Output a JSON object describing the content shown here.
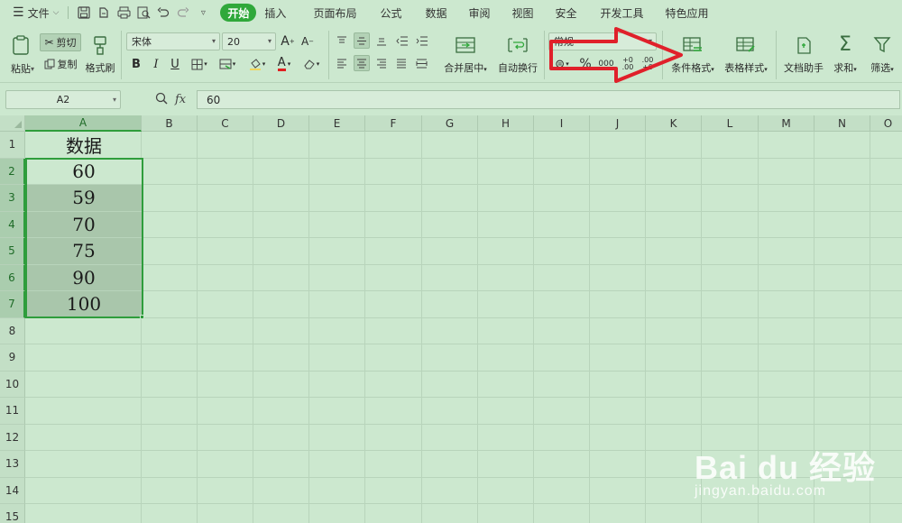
{
  "menubar": {
    "menu_label": "文件",
    "tabs": [
      "开始",
      "插入",
      "页面布局",
      "公式",
      "数据",
      "审阅",
      "视图",
      "安全",
      "开发工具",
      "特色应用"
    ],
    "active_tab": "开始"
  },
  "ribbon": {
    "paste": "粘贴",
    "cut": "剪切",
    "copy": "复制",
    "format_painter": "格式刷",
    "font_name": "宋体",
    "font_size": "20",
    "bold": "B",
    "italic": "I",
    "underline": "U",
    "merge_center": "合并居中",
    "wrap_text": "自动换行",
    "number_format": "常规",
    "percent": "%",
    "thousands": "000",
    "inc_decimal_top": "+0",
    "inc_decimal_bottom": ".00",
    "dec_decimal_top": ".00",
    "dec_decimal_bottom": "+0",
    "conditional_format": "条件格式",
    "table_style": "表格样式",
    "doc_helper": "文档助手",
    "sum": "求和",
    "filter": "筛选"
  },
  "formula_bar": {
    "name_box": "A2",
    "fx": "fx",
    "value": "60"
  },
  "sheet": {
    "columns": [
      "A",
      "B",
      "C",
      "D",
      "E",
      "F",
      "G",
      "H",
      "I",
      "J",
      "K",
      "L",
      "M",
      "N",
      "O"
    ],
    "rows": [
      "1",
      "2",
      "3",
      "4",
      "5",
      "6",
      "7",
      "8",
      "9",
      "10",
      "11",
      "12",
      "13",
      "14",
      "15"
    ],
    "cells": {
      "A1": "数据",
      "A2": "60",
      "A3": "59",
      "A4": "70",
      "A5": "75",
      "A6": "90",
      "A7": "100"
    },
    "selection": "A2:A7",
    "active_cell": "A2"
  },
  "annotation": {
    "arrow_color": "#e0202a",
    "points_to": "conditional_format"
  },
  "watermark": {
    "brand": "Bai du 经验",
    "site": "jingyan.baidu.com"
  },
  "colors": {
    "background": "#cce8cf",
    "accent": "#2fa83a",
    "selection_fill": "#a9c6ab"
  }
}
